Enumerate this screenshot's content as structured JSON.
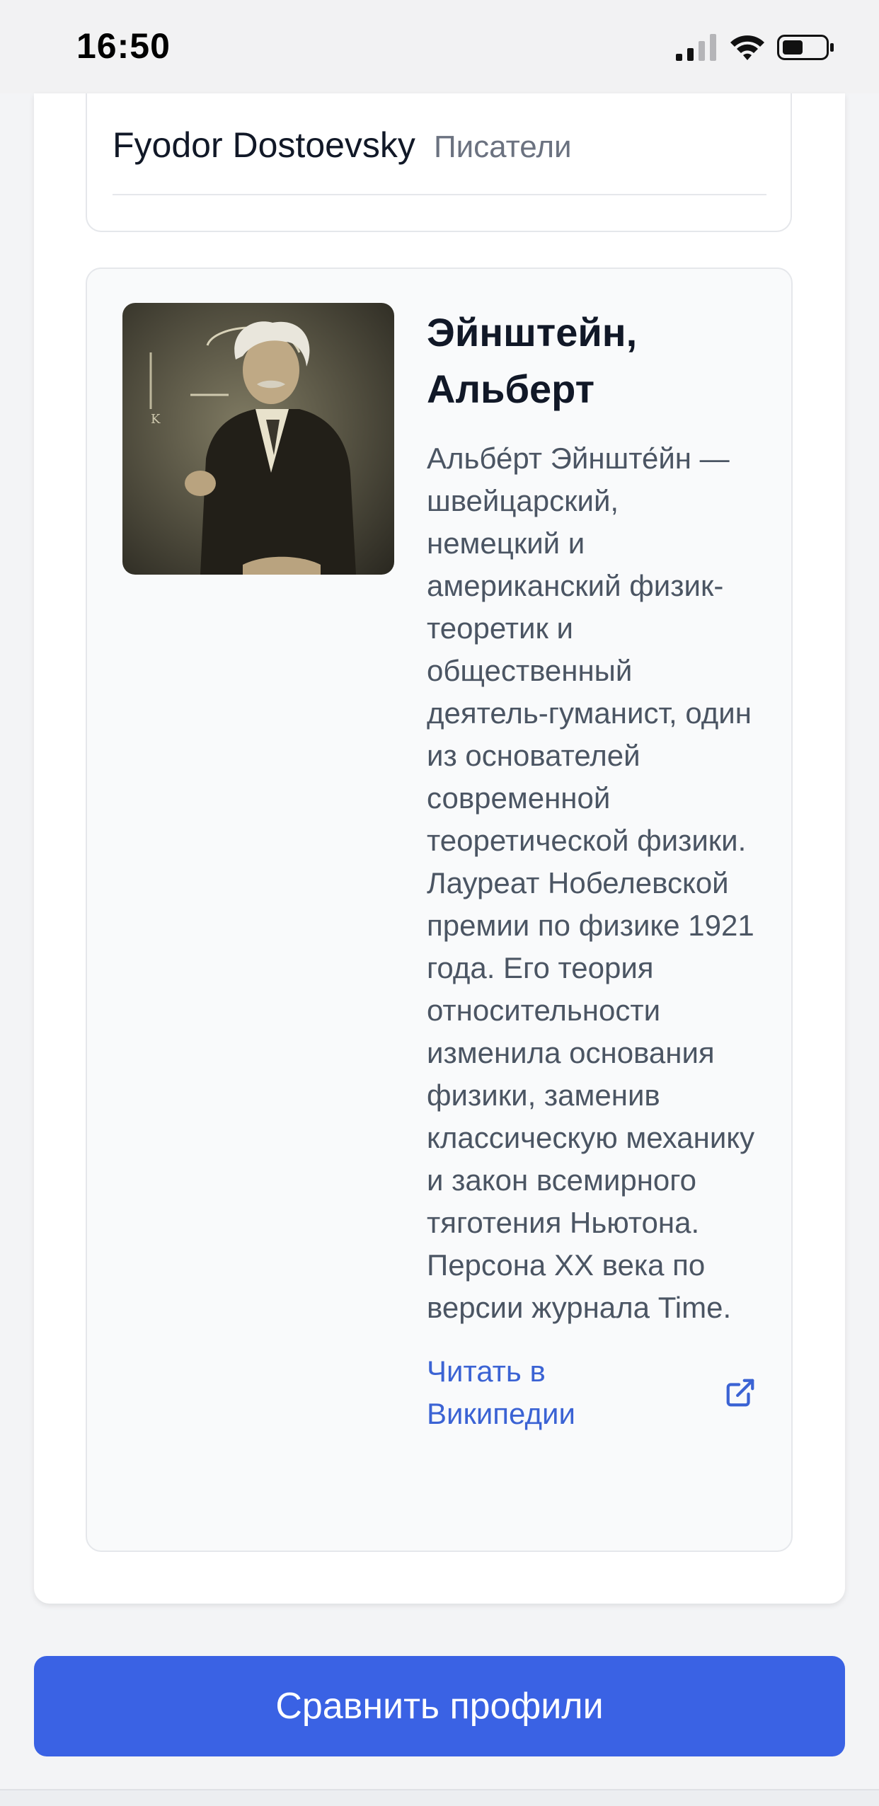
{
  "status_bar": {
    "time": "16:50",
    "icons": [
      "signal-icon",
      "wifi-icon",
      "battery-icon"
    ]
  },
  "top_item": {
    "name": "Fyodor Dostoevsky",
    "group": "Писатели"
  },
  "profile": {
    "name": "Эйнштейн, Альберт",
    "description": "Альбе́рт Эйнште́йн — швейцарский, немецкий и американский физик-теоретик и общественный деятель-гуманист, один из основателей современной теоретической физики. Лауреат Нобелевской премии по физике 1921 года. Его теория относительности изменила основания физики, заменив классическую механику и закон всемирного тяготения Ньютона. Персона XX века по версии журнала Time.",
    "link_label": "Читать в Википедии",
    "link_icon": "external-link-icon",
    "photo_icon": "portrait-photo"
  },
  "compare_button": {
    "label": "Сравнить профили"
  },
  "colors": {
    "accent": "#3a62e4",
    "link": "#3b63d4",
    "card_background": "#f9fafb"
  }
}
